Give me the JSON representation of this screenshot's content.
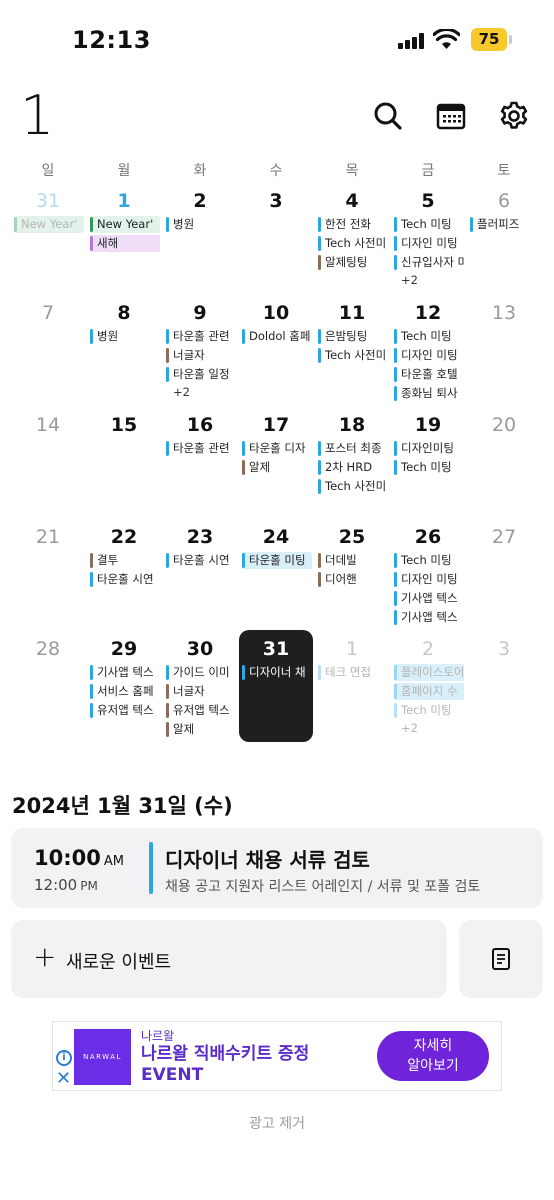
{
  "status_bar": {
    "time": "12:13",
    "battery": "75"
  },
  "header": {
    "month": "1"
  },
  "weekdays": [
    "일",
    "월",
    "화",
    "수",
    "목",
    "금",
    "토"
  ],
  "colors": {
    "blue": "#2aa6e2",
    "green": "#2e9a5c",
    "purple": "#b27ad6",
    "brown": "#8b6b5a",
    "selected": "#1f1f1f",
    "ad_purple": "#6f24d9"
  },
  "weeks": [
    {
      "days": [
        {
          "num": "31",
          "events": [
            {
              "label": "New Year'",
              "color": "green",
              "faded": true,
              "style": "hl-green"
            }
          ]
        },
        {
          "num": "1",
          "events": [
            {
              "label": "New Year'",
              "color": "green",
              "style": "hl-green"
            },
            {
              "label": "새해",
              "color": "purple",
              "style": "hl-purple"
            }
          ]
        },
        {
          "num": "2",
          "events": [
            {
              "label": "병원",
              "color": "blue"
            }
          ]
        },
        {
          "num": "3",
          "events": []
        },
        {
          "num": "4",
          "events": [
            {
              "label": "한전 전화",
              "color": "blue"
            },
            {
              "label": "Tech 사전미",
              "color": "blue"
            },
            {
              "label": "알제팅팅",
              "color": "brown"
            }
          ]
        },
        {
          "num": "5",
          "events": [
            {
              "label": "Tech 미팅",
              "color": "blue"
            },
            {
              "label": "디자인 미팅",
              "color": "blue"
            },
            {
              "label": "신규입사자 미",
              "color": "blue"
            }
          ],
          "more": "+2"
        },
        {
          "num": "6",
          "events": [
            {
              "label": "플러피즈",
              "color": "blue"
            }
          ]
        }
      ]
    },
    {
      "days": [
        {
          "num": "7",
          "events": []
        },
        {
          "num": "8",
          "events": [
            {
              "label": "병원",
              "color": "blue"
            }
          ]
        },
        {
          "num": "9",
          "events": [
            {
              "label": "타운홀 관련",
              "color": "blue"
            },
            {
              "label": "너글자",
              "color": "brown"
            },
            {
              "label": "타운홀 일정",
              "color": "blue"
            }
          ],
          "more": "+2"
        },
        {
          "num": "10",
          "events": [
            {
              "label": "Doldol 홈페",
              "color": "blue"
            }
          ]
        },
        {
          "num": "11",
          "events": [
            {
              "label": "은밤팅팅",
              "color": "blue"
            },
            {
              "label": "Tech 사전미",
              "color": "blue"
            }
          ]
        },
        {
          "num": "12",
          "events": [
            {
              "label": "Tech 미팅",
              "color": "blue"
            },
            {
              "label": "디자인 미팅",
              "color": "blue"
            },
            {
              "label": "타운홀 호텔",
              "color": "blue"
            },
            {
              "label": "종화님 퇴사",
              "color": "blue"
            }
          ]
        },
        {
          "num": "13",
          "events": []
        }
      ]
    },
    {
      "days": [
        {
          "num": "14",
          "events": []
        },
        {
          "num": "15",
          "events": []
        },
        {
          "num": "16",
          "events": [
            {
              "label": "타운홀 관련",
              "color": "blue"
            }
          ]
        },
        {
          "num": "17",
          "events": [
            {
              "label": "타운홀 디자",
              "color": "blue"
            },
            {
              "label": "알제",
              "color": "brown"
            }
          ]
        },
        {
          "num": "18",
          "events": [
            {
              "label": "포스터 최종",
              "color": "blue"
            },
            {
              "label": "2차 HRD",
              "color": "blue"
            },
            {
              "label": "Tech 사전미",
              "color": "blue"
            }
          ]
        },
        {
          "num": "19",
          "events": [
            {
              "label": "디자인미팅",
              "color": "blue"
            },
            {
              "label": "Tech 미팅",
              "color": "blue"
            }
          ]
        },
        {
          "num": "20",
          "events": []
        }
      ]
    },
    {
      "days": [
        {
          "num": "21",
          "events": []
        },
        {
          "num": "22",
          "events": [
            {
              "label": "결투",
              "color": "brown"
            },
            {
              "label": "타운홀 시연",
              "color": "blue"
            }
          ]
        },
        {
          "num": "23",
          "events": [
            {
              "label": "타운홀 시연",
              "color": "blue"
            }
          ]
        },
        {
          "num": "24",
          "events": [
            {
              "label": "타운홀 미팅",
              "color": "blue",
              "style": "hl"
            }
          ]
        },
        {
          "num": "25",
          "events": [
            {
              "label": "더데빌",
              "color": "brown"
            },
            {
              "label": "디어핸",
              "color": "brown"
            }
          ]
        },
        {
          "num": "26",
          "events": [
            {
              "label": "Tech 미팅",
              "color": "blue"
            },
            {
              "label": "디자인 미팅",
              "color": "blue"
            },
            {
              "label": "기사앱 텍스",
              "color": "blue"
            },
            {
              "label": "기사앱 텍스",
              "color": "blue"
            }
          ]
        },
        {
          "num": "27",
          "events": []
        }
      ]
    },
    {
      "days": [
        {
          "num": "28",
          "events": []
        },
        {
          "num": "29",
          "events": [
            {
              "label": "기사앱 텍스",
              "color": "blue"
            },
            {
              "label": "서비스 홈페",
              "color": "blue"
            },
            {
              "label": "유저앱 텍스",
              "color": "blue"
            }
          ]
        },
        {
          "num": "30",
          "events": [
            {
              "label": "가이드 이미",
              "color": "blue"
            },
            {
              "label": "너글자",
              "color": "brown"
            },
            {
              "label": "유저앱 텍스",
              "color": "brown"
            },
            {
              "label": "알제",
              "color": "brown"
            }
          ]
        },
        {
          "num": "31",
          "events": [
            {
              "label": "디자이너 채",
              "color": "blue"
            }
          ]
        },
        {
          "num": "1",
          "events": [
            {
              "label": "테크 면접",
              "color": "blue",
              "faded": true
            }
          ]
        },
        {
          "num": "2",
          "events": [
            {
              "label": "플레이스토어",
              "color": "blue",
              "faded": true,
              "style": "hl"
            },
            {
              "label": "홈페이지 수",
              "color": "blue",
              "faded": true,
              "style": "hl"
            },
            {
              "label": "Tech 미팅",
              "color": "blue",
              "faded": true
            }
          ],
          "more": "+2"
        },
        {
          "num": "3",
          "events": []
        }
      ]
    }
  ],
  "selected_date": "2024년 1월 31일 (수)",
  "event": {
    "start_time": "10:00",
    "start_ampm": "AM",
    "end_time": "12:00",
    "end_ampm": "PM",
    "title": "디자이너 채용 서류 검토",
    "description": "채용 공고 지원자 리스트 어레인지 / 서류 및 포폴 검토"
  },
  "new_event": {
    "label": "새로운 이벤트"
  },
  "ad": {
    "logo_text": "NARWAL",
    "brand": "나르왈",
    "headline_line1": "나르왈 직배수키트 증정",
    "headline_line2": "EVENT",
    "cta_line1": "자세히",
    "cta_line2": "알아보기"
  },
  "remove_ad": "광고 제거"
}
